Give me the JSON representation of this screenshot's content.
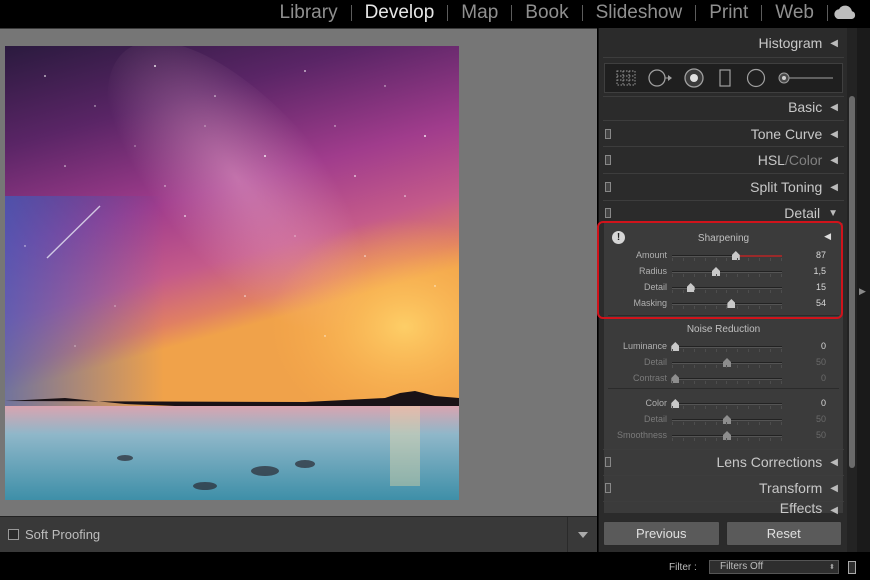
{
  "modules": [
    "Library",
    "Develop",
    "Map",
    "Book",
    "Slideshow",
    "Print",
    "Web"
  ],
  "active_module": "Develop",
  "toolbar": {
    "soft_proofing": "Soft Proofing"
  },
  "panels": {
    "histogram": "Histogram",
    "basic": "Basic",
    "tone_curve": "Tone Curve",
    "hsl": "HSL",
    "hsl_sep": " / ",
    "color": "Color",
    "split_toning": "Split Toning",
    "detail": "Detail",
    "lens_corrections": "Lens Corrections",
    "transform": "Transform",
    "effects": "Effects"
  },
  "sharpening": {
    "title": "Sharpening",
    "sliders": [
      {
        "label": "Amount",
        "value": "87",
        "pos": 0.58
      },
      {
        "label": "Radius",
        "value": "1,5",
        "pos": 0.4
      },
      {
        "label": "Detail",
        "value": "15",
        "pos": 0.17
      },
      {
        "label": "Masking",
        "value": "54",
        "pos": 0.54
      }
    ]
  },
  "noise_reduction": {
    "title": "Noise Reduction",
    "luminance": [
      {
        "label": "Luminance",
        "value": "0",
        "pos": 0.03,
        "disabled": false
      },
      {
        "label": "Detail",
        "value": "50",
        "pos": 0.5,
        "disabled": true
      },
      {
        "label": "Contrast",
        "value": "0",
        "pos": 0.03,
        "disabled": true
      }
    ],
    "color": [
      {
        "label": "Color",
        "value": "0",
        "pos": 0.03,
        "disabled": false
      },
      {
        "label": "Detail",
        "value": "50",
        "pos": 0.5,
        "disabled": true
      },
      {
        "label": "Smoothness",
        "value": "50",
        "pos": 0.5,
        "disabled": true
      }
    ]
  },
  "buttons": {
    "previous": "Previous",
    "reset": "Reset"
  },
  "filter": {
    "label": "Filter :",
    "value": "Filters Off"
  },
  "colors": {
    "highlight": "#d0131b",
    "amount_fill": "#9a2a2a"
  }
}
